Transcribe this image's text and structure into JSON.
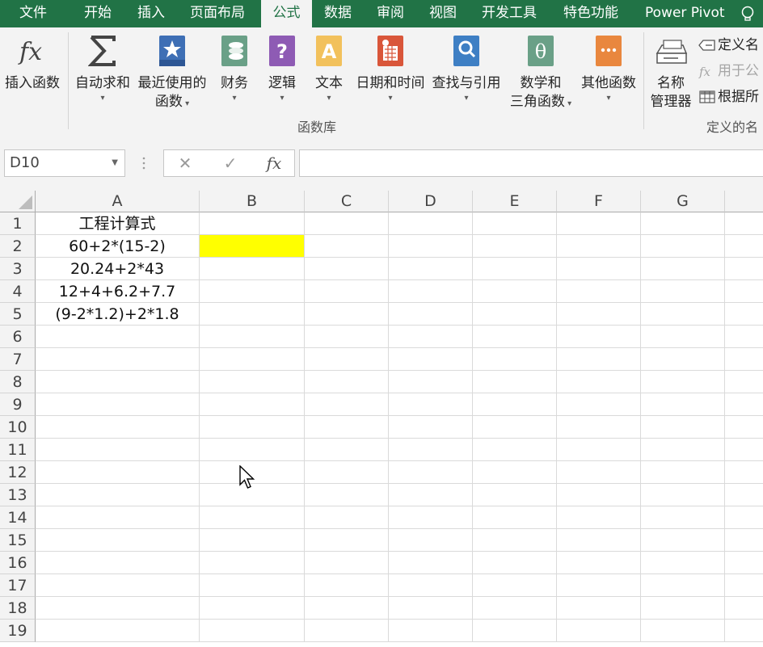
{
  "ribbon_tabs": [
    "文件",
    "开始",
    "插入",
    "页面布局",
    "公式",
    "数据",
    "审阅",
    "视图",
    "开发工具",
    "特色功能",
    "Power Pivot"
  ],
  "active_tab": "公式",
  "function_library": {
    "insert_function": "插入函数",
    "autosum": "自动求和",
    "recent_line1": "最近使用的",
    "recent_line2": "函数",
    "financial": "财务",
    "logical": "逻辑",
    "text": "文本",
    "datetime": "日期和时间",
    "lookup": "查找与引用",
    "math_line1": "数学和",
    "math_line2": "三角函数",
    "more": "其他函数",
    "group_label": "函数库"
  },
  "defined_names": {
    "name_manager_line1": "名称",
    "name_manager_line2": "管理器",
    "define_name": "定义名",
    "use_in_formula": "用于公",
    "create_from_selection": "根据所",
    "group_label": "定义的名"
  },
  "formula_bar": {
    "name_box": "D10",
    "cancel_glyph": "✕",
    "enter_glyph": "✓",
    "fx_glyph": "fx",
    "content": ""
  },
  "columns": [
    "A",
    "B",
    "C",
    "D",
    "E",
    "F",
    "G",
    ""
  ],
  "rows": [
    "1",
    "2",
    "3",
    "4",
    "5",
    "6",
    "7",
    "8",
    "9",
    "10",
    "11",
    "12",
    "13",
    "14",
    "15",
    "16",
    "17",
    "18",
    "19"
  ],
  "cells": {
    "A1": "工程计算式",
    "A2": "60+2*(15-2)",
    "A3": "20.24+2*43",
    "A4": "12+4+6.2+7.7",
    "A5": "(9-2*1.2)+2*1.8"
  },
  "highlight_color": "#ffff00",
  "accent_color": "#217346"
}
